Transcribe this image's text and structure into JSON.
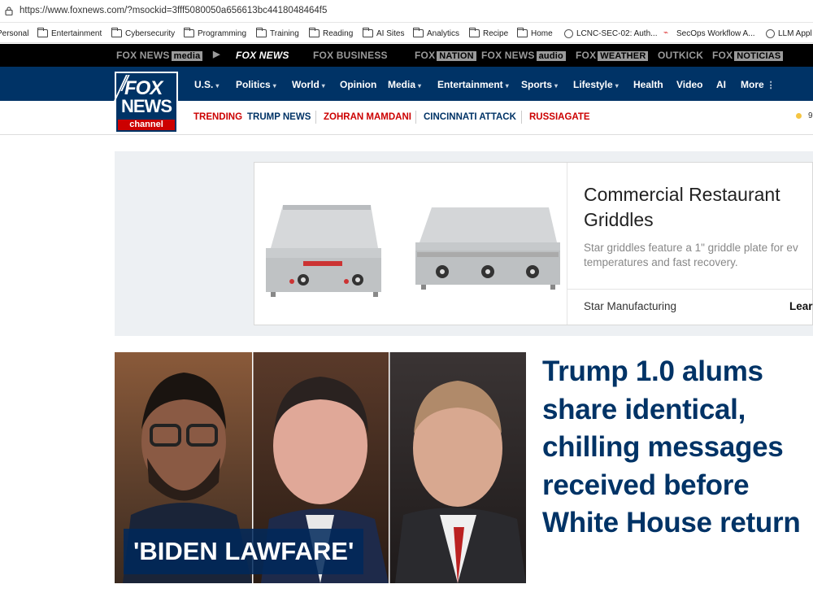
{
  "browser": {
    "url": "https://www.foxnews.com/?msockid=3fff5080050a656613bc4418048464f5",
    "bookmarks": [
      {
        "label": "Personal",
        "icon": "none"
      },
      {
        "label": "Entertainment",
        "icon": "folder-icon"
      },
      {
        "label": "Cybersecurity",
        "icon": "folder-icon"
      },
      {
        "label": "Programming",
        "icon": "folder-icon"
      },
      {
        "label": "Training",
        "icon": "folder-icon"
      },
      {
        "label": "Reading",
        "icon": "folder-icon"
      },
      {
        "label": "AI Sites",
        "icon": "folder-icon"
      },
      {
        "label": "Analytics",
        "icon": "folder-icon"
      },
      {
        "label": "Recipe",
        "icon": "folder-icon"
      },
      {
        "label": "Home",
        "icon": "folder-icon"
      },
      {
        "label": "LCNC-SEC-02: Auth...",
        "icon": "globe-icon"
      },
      {
        "label": "SecOps Workflow A...",
        "icon": "site-icon"
      },
      {
        "label": "LLM Appl",
        "icon": "globe-icon"
      }
    ]
  },
  "network_bar": {
    "items": [
      {
        "label": "FOX NEWS",
        "tag": "media"
      },
      {
        "label": "FOX NEWS",
        "tag": ""
      },
      {
        "label": "FOX BUSINESS",
        "tag": ""
      },
      {
        "label": "FOX",
        "tag": "NATION"
      },
      {
        "label": "FOX NEWS",
        "tag": "audio"
      },
      {
        "label": "FOX",
        "tag": "WEATHER"
      },
      {
        "label": "OUTKICK",
        "tag": ""
      },
      {
        "label": "FOX",
        "tag": "NOTICIAS"
      }
    ]
  },
  "logo": {
    "line1": "FOX",
    "line2": "NEWS",
    "line3": "channel"
  },
  "main_nav": [
    {
      "label": "U.S.",
      "caret": "▾"
    },
    {
      "label": "Politics",
      "caret": "▾"
    },
    {
      "label": "World",
      "caret": "▾"
    },
    {
      "label": "Opinion",
      "caret": ""
    },
    {
      "label": "Media",
      "caret": "▾"
    },
    {
      "label": "Entertainment",
      "caret": "▾"
    },
    {
      "label": "Sports",
      "caret": "▾"
    },
    {
      "label": "Lifestyle",
      "caret": "▾"
    },
    {
      "label": "Health",
      "caret": ""
    },
    {
      "label": "Video",
      "caret": ""
    },
    {
      "label": "AI",
      "caret": ""
    },
    {
      "label": "More",
      "caret": "⋮"
    }
  ],
  "trending": {
    "label": "TRENDING",
    "items": [
      "TRUMP NEWS",
      "ZOHRAN MAMDANI",
      "CINCINNATI ATTACK",
      "RUSSIAGATE"
    ],
    "weather": "9"
  },
  "ad": {
    "title": "Commercial Restaurant Griddles",
    "description_line1": "Star griddles feature a 1\" griddle plate for ev",
    "description_line2": "temperatures and fast recovery.",
    "brand": "Star Manufacturing",
    "cta": "Lear"
  },
  "hero": {
    "badge": "'BIDEN LAWFARE'",
    "headline": "Trump 1.0 alums share identical, chilling messages received before White House return"
  },
  "colors": {
    "nav_blue": "#003366",
    "trending_red": "#cc0000",
    "network_black": "#000000"
  }
}
